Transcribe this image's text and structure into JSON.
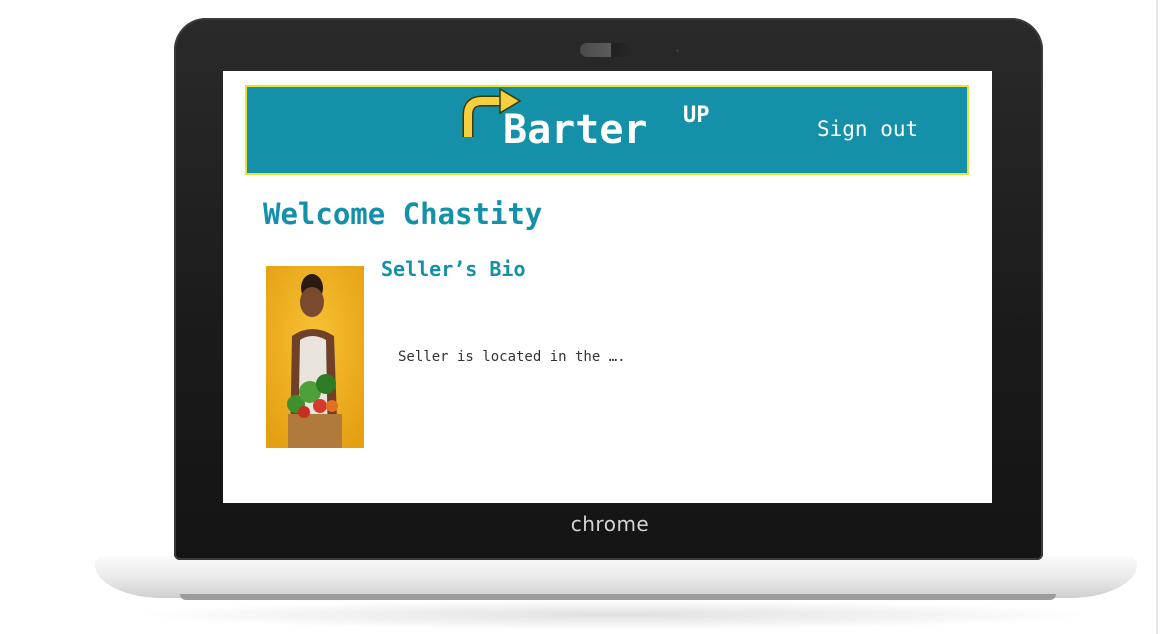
{
  "device": {
    "brand_label": "chrome"
  },
  "header": {
    "logo_text": "Barter",
    "logo_superscript": "UP",
    "sign_out_label": "Sign out"
  },
  "main": {
    "welcome_heading": "Welcome Chastity",
    "bio_heading": "Seller’s Bio",
    "bio_text": "Seller is located in the …."
  },
  "colors": {
    "header_bg": "#1590a9",
    "header_border": "#e8e23a",
    "accent_text": "#1590a9",
    "logo_arrow": "#f4d03f"
  },
  "icons": {
    "logo_arrow": "curved-arrow-icon",
    "seller_photo": "person-with-vegetables-photo"
  }
}
